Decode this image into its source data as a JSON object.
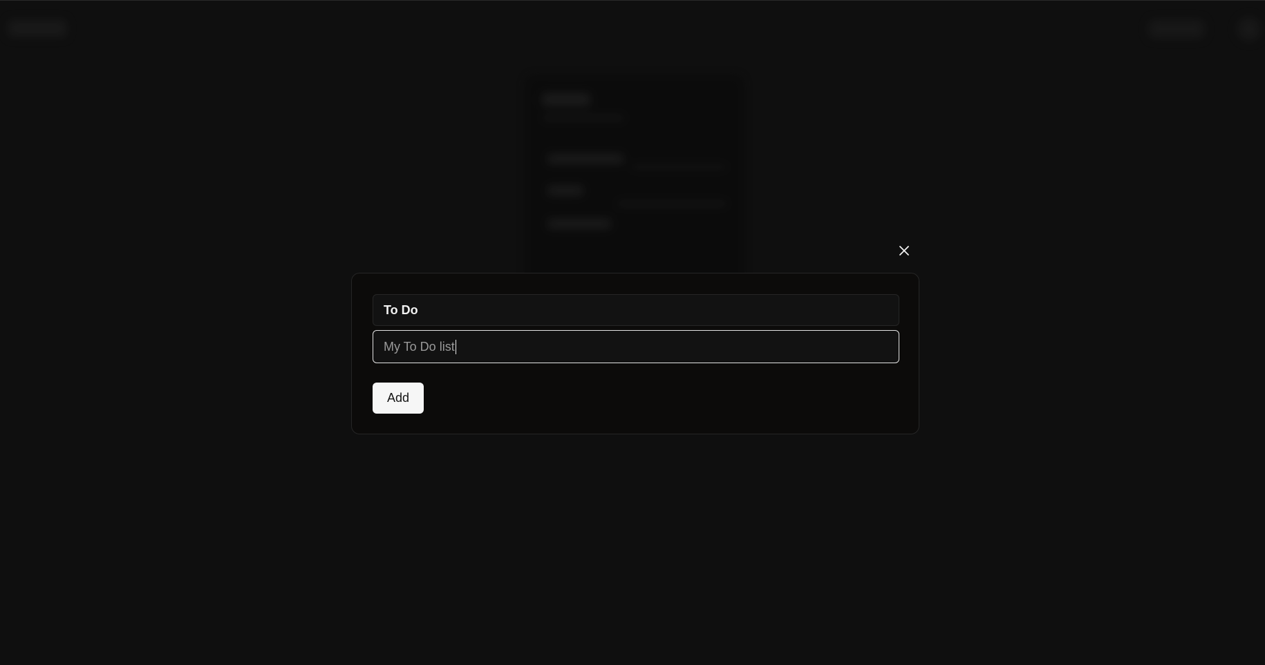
{
  "dialog": {
    "title_value": "To Do",
    "description_value": "My To Do list",
    "add_label": "Add",
    "close_icon": "close-icon"
  },
  "colors": {
    "page_background": "#141414",
    "dialog_background": "#0c0b0a",
    "button_background": "#f6f6f6",
    "button_text": "#141414",
    "focused_border": "#e4e4e4"
  }
}
